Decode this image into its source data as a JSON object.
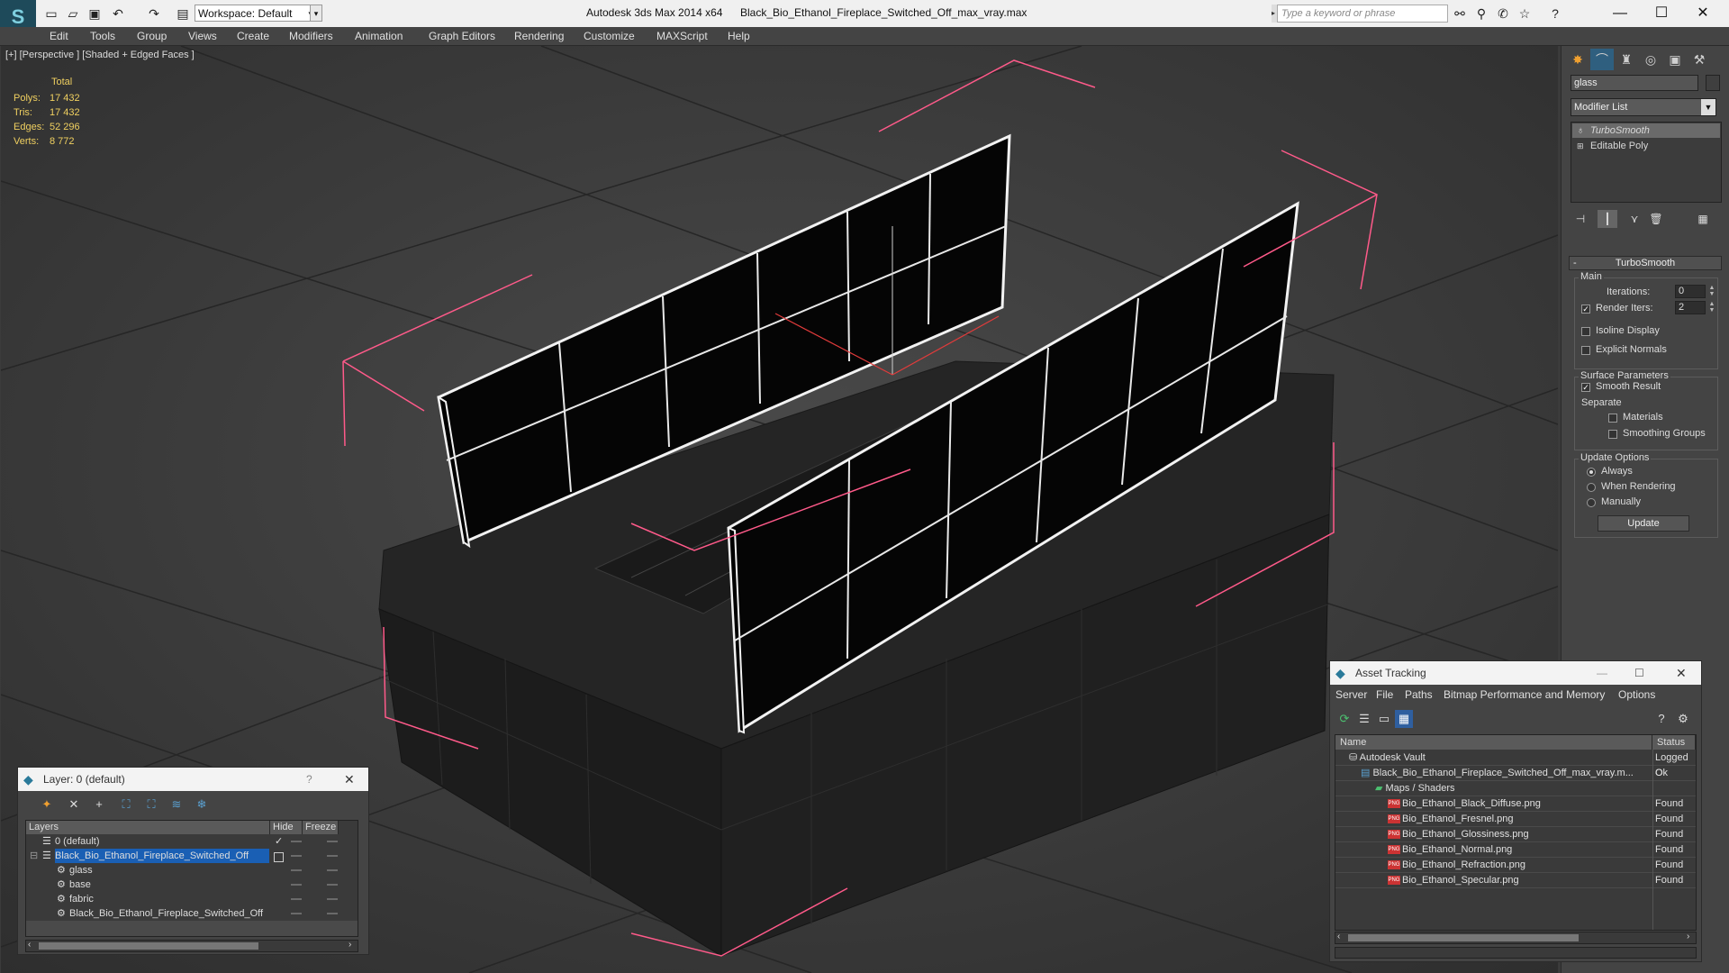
{
  "titlebar": {
    "workspace_label": "Workspace: Default",
    "app_title": "Autodesk 3ds Max  2014 x64",
    "file_title": "Black_Bio_Ethanol_Fireplace_Switched_Off_max_vray.max",
    "search_placeholder": "Type a keyword or phrase",
    "minimize": "—",
    "maximize": "☐",
    "close": "✕"
  },
  "menu": [
    "Edit",
    "Tools",
    "Group",
    "Views",
    "Create",
    "Modifiers",
    "Animation",
    "Graph Editors",
    "Rendering",
    "Customize",
    "MAXScript",
    "Help"
  ],
  "viewport": {
    "label": "[+] [Perspective ] [Shaded + Edged Faces ]",
    "stats_header": "Total",
    "stats": [
      {
        "label": "Polys:",
        "value": "17 432"
      },
      {
        "label": "Tris:",
        "value": "17 432"
      },
      {
        "label": "Edges:",
        "value": "52 296"
      },
      {
        "label": "Verts:",
        "value": "8 772"
      }
    ]
  },
  "command_panel": {
    "object_name": "glass",
    "modifier_list": "Modifier List",
    "stack": [
      "TurboSmooth",
      "Editable Poly"
    ],
    "rollout_title": "TurboSmooth",
    "main_group": "Main",
    "iterations_label": "Iterations:",
    "iterations_value": "0",
    "render_iters_label": "Render Iters:",
    "render_iters_value": "2",
    "isoline_label": "Isoline Display",
    "explicit_normals_label": "Explicit Normals",
    "surface_group": "Surface Parameters",
    "smooth_result_label": "Smooth Result",
    "separate_label": "Separate",
    "materials_label": "Materials",
    "smoothing_groups_label": "Smoothing Groups",
    "update_group": "Update Options",
    "always_label": "Always",
    "when_rendering_label": "When Rendering",
    "manually_label": "Manually",
    "update_button": "Update"
  },
  "layer_window": {
    "title": "Layer: 0 (default)",
    "help": "?",
    "close": "✕",
    "col_layers": "Layers",
    "col_hide": "Hide",
    "col_freeze": "Freeze",
    "rows": [
      {
        "name": "0 (default)",
        "indent": 0
      },
      {
        "name": "Black_Bio_Ethanol_Fireplace_Switched_Off",
        "indent": 0
      },
      {
        "name": "glass",
        "indent": 1
      },
      {
        "name": "base",
        "indent": 1
      },
      {
        "name": "fabric",
        "indent": 1
      },
      {
        "name": "Black_Bio_Ethanol_Fireplace_Switched_Off",
        "indent": 1
      }
    ]
  },
  "asset_window": {
    "title": "Asset Tracking",
    "minimize": "—",
    "maximize": "☐",
    "close": "✕",
    "menu": [
      "Server",
      "File",
      "Paths",
      "Bitmap Performance and Memory",
      "Options"
    ],
    "col_name": "Name",
    "col_status": "Status",
    "rows": [
      {
        "name": "Autodesk Vault",
        "status": "Logged O"
      },
      {
        "name": "Black_Bio_Ethanol_Fireplace_Switched_Off_max_vray.m...",
        "status": "Ok"
      },
      {
        "name": "Maps / Shaders",
        "status": ""
      },
      {
        "name": "Bio_Ethanol_Black_Diffuse.png",
        "status": "Found"
      },
      {
        "name": "Bio_Ethanol_Fresnel.png",
        "status": "Found"
      },
      {
        "name": "Bio_Ethanol_Glossiness.png",
        "status": "Found"
      },
      {
        "name": "Bio_Ethanol_Normal.png",
        "status": "Found"
      },
      {
        "name": "Bio_Ethanol_Refraction.png",
        "status": "Found"
      },
      {
        "name": "Bio_Ethanol_Specular.png",
        "status": "Found"
      }
    ]
  },
  "icons": {
    "png_file": "PNG"
  },
  "colors": {
    "selection_blue": "#1a5fb4",
    "stats_yellow": "#f0d060",
    "gizmo_pink": "#ff5a8a"
  }
}
